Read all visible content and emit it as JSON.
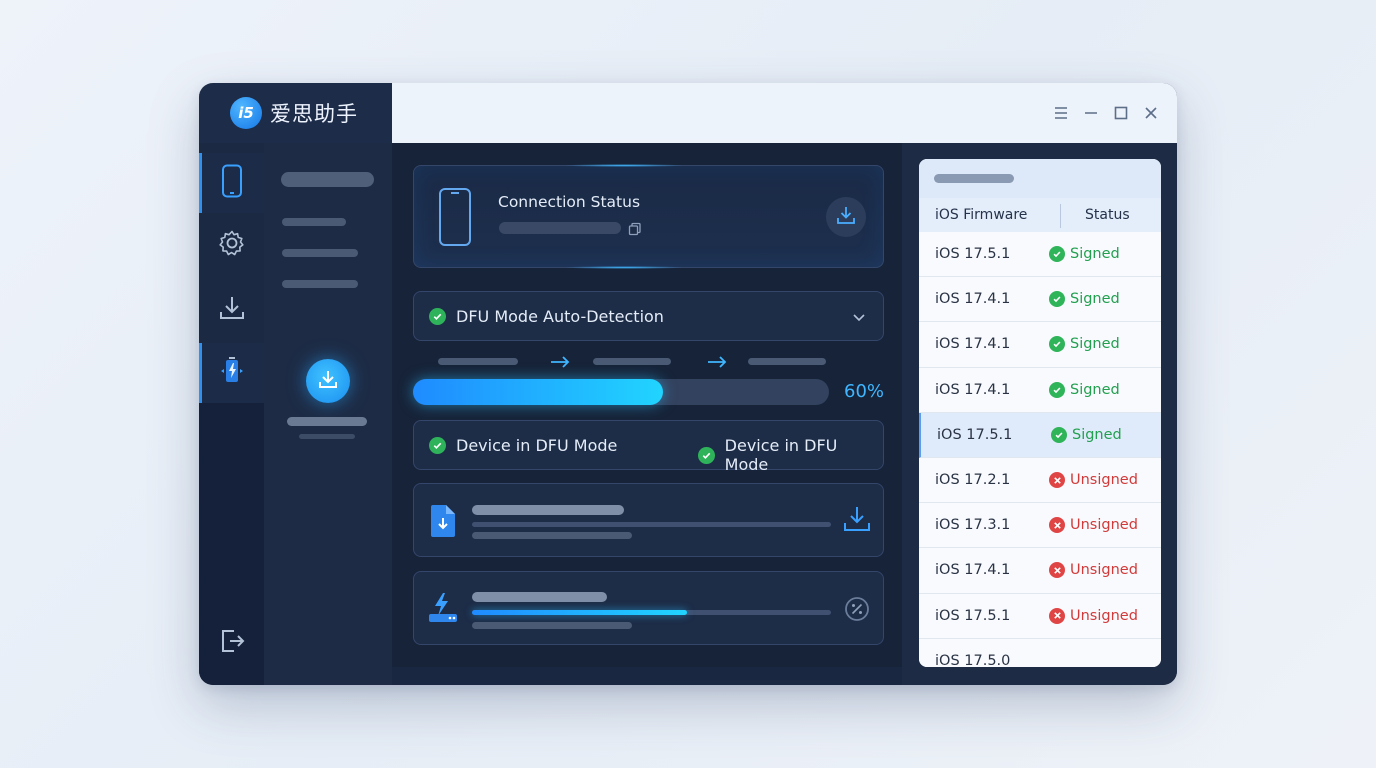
{
  "app": {
    "logo_text": "i5",
    "name": "爱思助手"
  },
  "connection": {
    "title": "Connection Status"
  },
  "dfu": {
    "label": "DFU Mode Auto-Detection",
    "progress_percent": 60,
    "progress_text": "60%",
    "status_left": "Device in DFU Mode",
    "status_right": "Device in DFU Mode"
  },
  "flash": {
    "progress_percent": 60
  },
  "firmware": {
    "col_version": "iOS Firmware",
    "col_status": "Status",
    "rows": [
      {
        "version": "iOS 17.5.1",
        "status": "Signed",
        "signed": true
      },
      {
        "version": "iOS 17.4.1",
        "status": "Signed",
        "signed": true
      },
      {
        "version": "iOS 17.4.1",
        "status": "Signed",
        "signed": true
      },
      {
        "version": "iOS 17.4.1",
        "status": "Signed",
        "signed": true
      },
      {
        "version": "iOS 17.5.1",
        "status": "Signed",
        "signed": true,
        "selected": true
      },
      {
        "version": "iOS 17.2.1",
        "status": "Unsigned",
        "signed": false
      },
      {
        "version": "iOS 17.3.1",
        "status": "Unsigned",
        "signed": false
      },
      {
        "version": "iOS 17.4.1",
        "status": "Unsigned",
        "signed": false
      },
      {
        "version": "iOS 17.5.1",
        "status": "Unsigned",
        "signed": false
      },
      {
        "version": "iOS 17.5.0",
        "status": "",
        "signed": null
      }
    ]
  },
  "colors": {
    "accent": "#2f90f0",
    "progress_start": "#1f8bff",
    "progress_end": "#21d4ff",
    "signed": "#22a050",
    "unsigned": "#d23a3a"
  }
}
